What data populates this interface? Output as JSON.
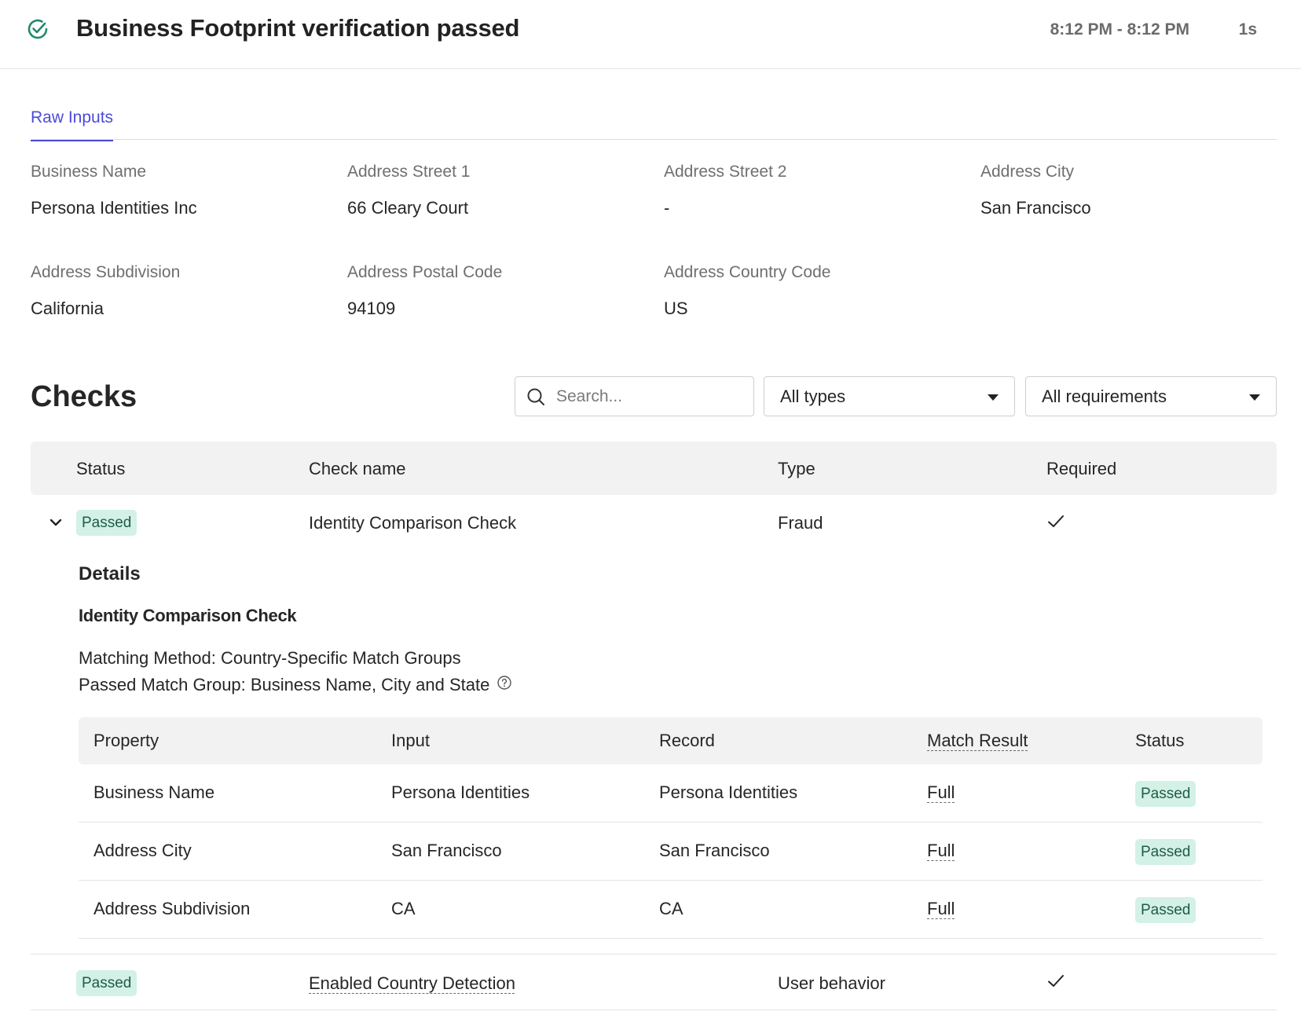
{
  "header": {
    "title": "Business Footprint verification passed",
    "time_range": "8:12 PM - 8:12 PM",
    "duration": "1s",
    "status_icon": "check-circle-icon",
    "accent_color": "#1f8a6c"
  },
  "tabs": [
    {
      "label": "Raw Inputs",
      "active": true
    }
  ],
  "raw_inputs": [
    {
      "label": "Business Name",
      "value": "Persona Identities Inc"
    },
    {
      "label": "Address Street 1",
      "value": "66 Cleary Court"
    },
    {
      "label": "Address Street 2",
      "value": "-"
    },
    {
      "label": "Address City",
      "value": "San Francisco"
    },
    {
      "label": "Address Subdivision",
      "value": "California"
    },
    {
      "label": "Address Postal Code",
      "value": "94109"
    },
    {
      "label": "Address Country Code",
      "value": "US"
    }
  ],
  "checks": {
    "title": "Checks",
    "search_placeholder": "Search...",
    "filters": {
      "type": "All types",
      "requirement": "All requirements"
    },
    "columns": {
      "status": "Status",
      "name": "Check name",
      "type": "Type",
      "required": "Required"
    },
    "rows": [
      {
        "status": "Passed",
        "name": "Identity Comparison Check",
        "type": "Fraud",
        "required": true,
        "expanded": true
      },
      {
        "status": "Passed",
        "name": "Enabled Country Detection",
        "type": "User behavior",
        "required": true,
        "expanded": false
      }
    ],
    "details": {
      "title": "Details",
      "subtitle": "Identity Comparison Check",
      "matching_method": "Matching Method: Country-Specific Match Groups",
      "passed_group": "Passed Match Group: Business Name, City and State",
      "columns": {
        "property": "Property",
        "input": "Input",
        "record": "Record",
        "match_result": "Match Result",
        "status": "Status"
      },
      "rows": [
        {
          "property": "Business Name",
          "input": "Persona Identities",
          "record": "Persona Identities",
          "match_result": "Full",
          "status": "Passed"
        },
        {
          "property": "Address City",
          "input": "San Francisco",
          "record": "San Francisco",
          "match_result": "Full",
          "status": "Passed"
        },
        {
          "property": "Address Subdivision",
          "input": "CA",
          "record": "CA",
          "match_result": "Full",
          "status": "Passed"
        }
      ]
    }
  },
  "colors": {
    "tab_active": "#4b4bd8",
    "badge_bg": "#d3f1e6",
    "badge_text": "#1f5c46",
    "header_bg": "#f2f2f2"
  }
}
